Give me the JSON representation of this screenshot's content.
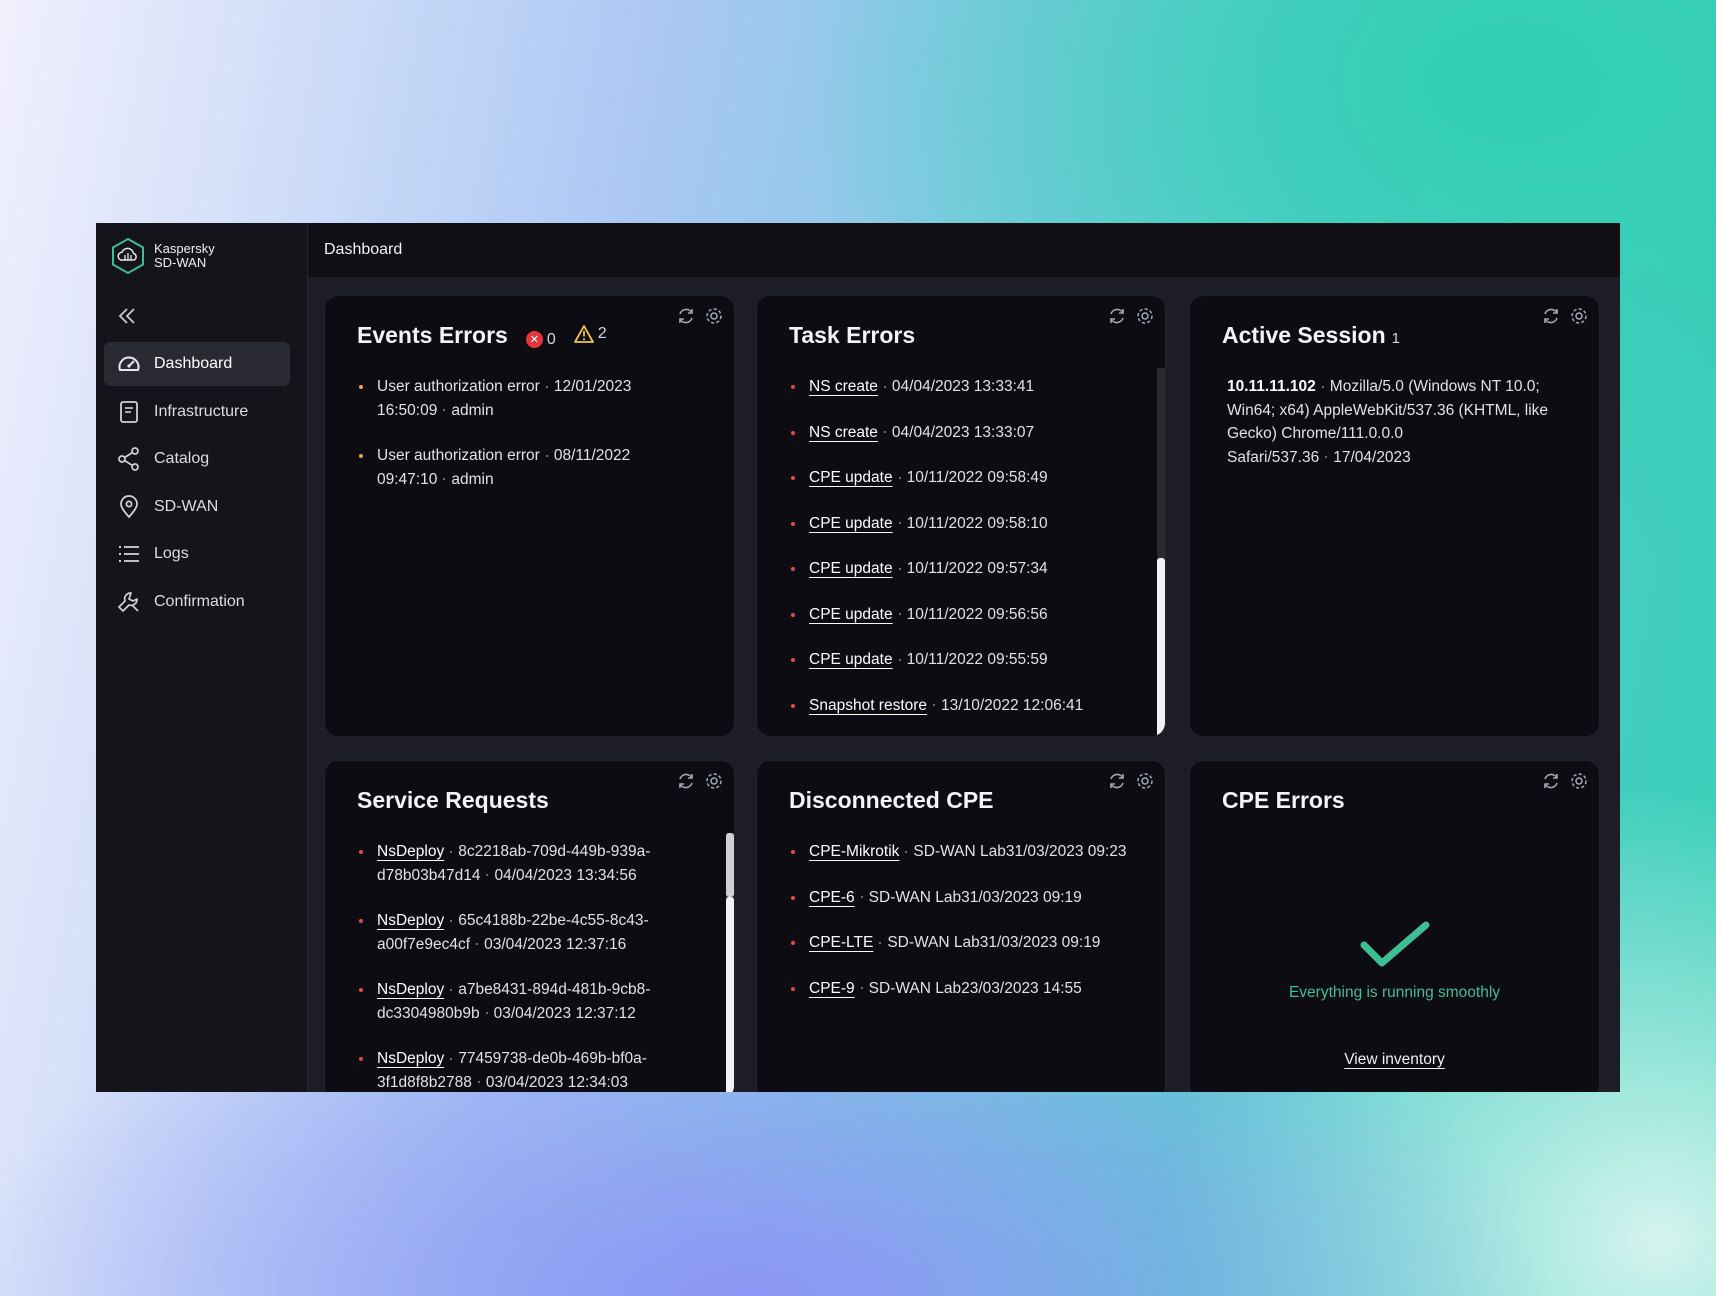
{
  "app": {
    "brand_line1": "Kaspersky",
    "brand_line2": "SD-WAN",
    "page_title": "Dashboard"
  },
  "sidebar": {
    "items": [
      {
        "label": "Dashboard",
        "icon": "gauge-icon",
        "active": true
      },
      {
        "label": "Infrastructure",
        "icon": "document-icon"
      },
      {
        "label": "Catalog",
        "icon": "share-icon"
      },
      {
        "label": "SD-WAN",
        "icon": "location-pin-icon"
      },
      {
        "label": "Logs",
        "icon": "list-icon"
      },
      {
        "label": "Confirmation",
        "icon": "wrench-icon"
      }
    ]
  },
  "events_errors": {
    "title": "Events Errors",
    "error_count": "0",
    "warning_count": "2",
    "items": [
      {
        "text": "User authorization error",
        "date": "12/01/2023",
        "time": "16:50:09",
        "user": "admin"
      },
      {
        "text": "User authorization error",
        "date": "08/11/2022",
        "time": "09:47:10",
        "user": "admin"
      }
    ]
  },
  "task_errors": {
    "title": "Task Errors",
    "items": [
      {
        "name": "NS create",
        "timestamp": "04/04/2023 13:33:41"
      },
      {
        "name": "NS create",
        "timestamp": "04/04/2023 13:33:07"
      },
      {
        "name": "CPE update",
        "timestamp": "10/11/2022 09:58:49"
      },
      {
        "name": "CPE update",
        "timestamp": "10/11/2022 09:58:10"
      },
      {
        "name": "CPE update",
        "timestamp": "10/11/2022 09:57:34"
      },
      {
        "name": "CPE update",
        "timestamp": "10/11/2022 09:56:56"
      },
      {
        "name": "CPE update",
        "timestamp": "10/11/2022 09:55:59"
      },
      {
        "name": "Snapshot restore",
        "timestamp": "13/10/2022 12:06:41"
      }
    ]
  },
  "active_session": {
    "title": "Active Session",
    "count": "1",
    "ip": "10.11.11.102",
    "agent_line1": "Mozilla/5.0 (Windows NT 10.0;",
    "agent_line2": "Win64; x64) AppleWebKit/537.36 (KHTML, like",
    "agent_line3": "Gecko) Chrome/111.0.0.0",
    "agent_line4": "Safari/537.36",
    "date": "17/04/2023"
  },
  "service_requests": {
    "title": "Service Requests",
    "items": [
      {
        "name": "NsDeploy",
        "id_part1": "8c2218ab-709d-449b-939a-",
        "id_part2": "d78b03b47d14",
        "timestamp": "04/04/2023 13:34:56"
      },
      {
        "name": "NsDeploy",
        "id_part1": "65c4188b-22be-4c55-8c43-",
        "id_part2": "a00f7e9ec4cf",
        "timestamp": "03/04/2023 12:37:16"
      },
      {
        "name": "NsDeploy",
        "id_part1": "a7be8431-894d-481b-9cb8-",
        "id_part2": "dc3304980b9b",
        "timestamp": "03/04/2023 12:37:12"
      },
      {
        "name": "NsDeploy",
        "id_part1": "77459738-de0b-469b-bf0a-",
        "id_part2": "3f1d8f8b2788",
        "timestamp": "03/04/2023 12:34:03"
      }
    ]
  },
  "disconnected_cpe": {
    "title": "Disconnected CPE",
    "items": [
      {
        "name": "CPE-Mikrotik",
        "detail": "SD-WAN Lab31/03/2023 09:23"
      },
      {
        "name": "CPE-6",
        "detail": "SD-WAN Lab31/03/2023 09:19"
      },
      {
        "name": "CPE-LTE",
        "detail": "SD-WAN Lab31/03/2023 09:19"
      },
      {
        "name": "CPE-9",
        "detail": "SD-WAN Lab23/03/2023 14:55"
      }
    ]
  },
  "cpe_errors": {
    "title": "CPE Errors",
    "status": "Everything is running smoothly",
    "link": "View inventory"
  },
  "colors": {
    "accent_green": "#3dbf93",
    "error_red": "#e5343a",
    "warning_yellow": "#f0c43c",
    "background": "#1d1d26",
    "card": "#0c0c12"
  }
}
